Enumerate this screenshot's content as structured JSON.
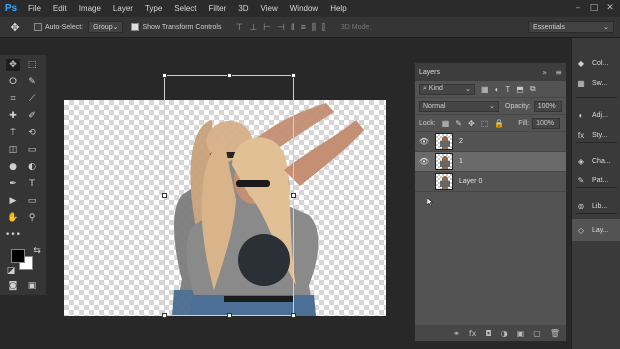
{
  "app": {
    "logo": "Ps"
  },
  "menu": [
    "File",
    "Edit",
    "Image",
    "Layer",
    "Type",
    "Select",
    "Filter",
    "3D",
    "View",
    "Window",
    "Help"
  ],
  "window_controls": {
    "minimize": "–",
    "maximize": "□",
    "close": "✕"
  },
  "options": {
    "move_icon": "✥",
    "auto_select_label": "Auto-Select:",
    "auto_select_target": "Group",
    "show_transform_label": "Show Transform Controls",
    "mode_3d_label": "3D Mode:",
    "workspace": "Essentials",
    "align_icons": [
      "⊤",
      "⊥",
      "⊢",
      "⊣",
      "‖",
      "≡",
      "⫼",
      "⫿"
    ]
  },
  "tools": {
    "move": "✥",
    "marquee": "⬚",
    "lasso": "ⵔ",
    "quick_select": "✎",
    "crop": "⌗",
    "eyedropper": "⟋",
    "healing": "✚",
    "brush": "✐",
    "stamp": "⍑",
    "history_brush": "⟲",
    "eraser": "◫",
    "gradient": "▭",
    "blur": "●",
    "dodge": "◐",
    "pen": "✒",
    "type": "T",
    "path_select": "▶",
    "shape": "▭",
    "hand": "✋",
    "zoom": "⚲",
    "more": "•••",
    "quick_mask": "◙",
    "screen_mode": "▣",
    "swap_colors": "⇆",
    "default_colors": "◪"
  },
  "layers_panel": {
    "title": "Layers",
    "collapse_icon": "»",
    "menu_icon": "≡",
    "filter_kind": "Kind",
    "filter_icons": [
      "▦",
      "◐",
      "T",
      "⬒",
      "⧉"
    ],
    "blend_mode": "Normal",
    "opacity_label": "Opacity:",
    "opacity_value": "100%",
    "lock_label": "Lock:",
    "lock_icons": [
      "▦",
      "✎",
      "✥",
      "⬚",
      "🔒"
    ],
    "fill_label": "Fill:",
    "fill_value": "100%",
    "layers": [
      {
        "name": "2",
        "visible": true,
        "selected": false
      },
      {
        "name": "1",
        "visible": true,
        "selected": true
      },
      {
        "name": "Layer 0",
        "visible": false,
        "selected": false
      }
    ],
    "eye_icon": "👁",
    "footer_icons": [
      "⚭",
      "fx",
      "◘",
      "◑",
      "▣",
      "▢",
      "🗑"
    ]
  },
  "dock": [
    {
      "label": "Col...",
      "icon": "◆"
    },
    {
      "label": "Sw...",
      "icon": "▦"
    },
    {
      "label": "Adj...",
      "icon": "◐"
    },
    {
      "label": "Sty...",
      "icon": "fx"
    },
    {
      "label": "Cha...",
      "icon": "◈"
    },
    {
      "label": "Pat...",
      "icon": "✎"
    },
    {
      "label": "Lib...",
      "icon": "⊚"
    },
    {
      "label": "Lay...",
      "icon": "◇"
    }
  ]
}
